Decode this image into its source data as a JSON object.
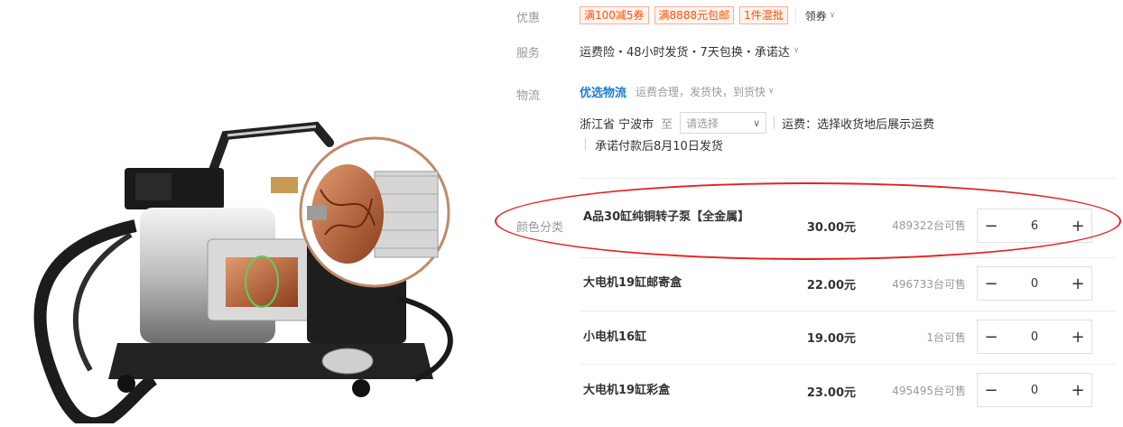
{
  "promo": {
    "label": "优惠",
    "coupons": [
      "满100减5券",
      "满8888元包邮",
      "1件混批"
    ],
    "get_coupon": "领券"
  },
  "service": {
    "label": "服务",
    "text": "运费险・48小时发货・7天包换・承诺达"
  },
  "logistics": {
    "label": "物流",
    "brand": "优选物流",
    "desc": "运费合理，发货快，到货快",
    "origin": "浙江省 宁波市",
    "to": "至",
    "select_placeholder": "请选择",
    "shipping": "运费：选择收货地后展示运费",
    "promise": "承诺付款后8月10日发货"
  },
  "sku": {
    "label": "颜色分类",
    "items": [
      {
        "name": "A品30缸纯铜转子泵【全金属】",
        "price": "30.00元",
        "stock": "489322台可售",
        "qty": "6"
      },
      {
        "name": "大电机19缸邮寄盒",
        "price": "22.00元",
        "stock": "496733台可售",
        "qty": "0"
      },
      {
        "name": "小电机16缸",
        "price": "19.00元",
        "stock": "1台可售",
        "qty": "0"
      },
      {
        "name": "大电机19缸彩盒",
        "price": "23.00元",
        "stock": "495495台可售",
        "qty": "0"
      }
    ]
  },
  "stepper": {
    "minus": "−",
    "plus": "+"
  },
  "colors": {
    "accent": "#ff5000",
    "link": "#1a7fd4",
    "annotation": "#e52222"
  }
}
